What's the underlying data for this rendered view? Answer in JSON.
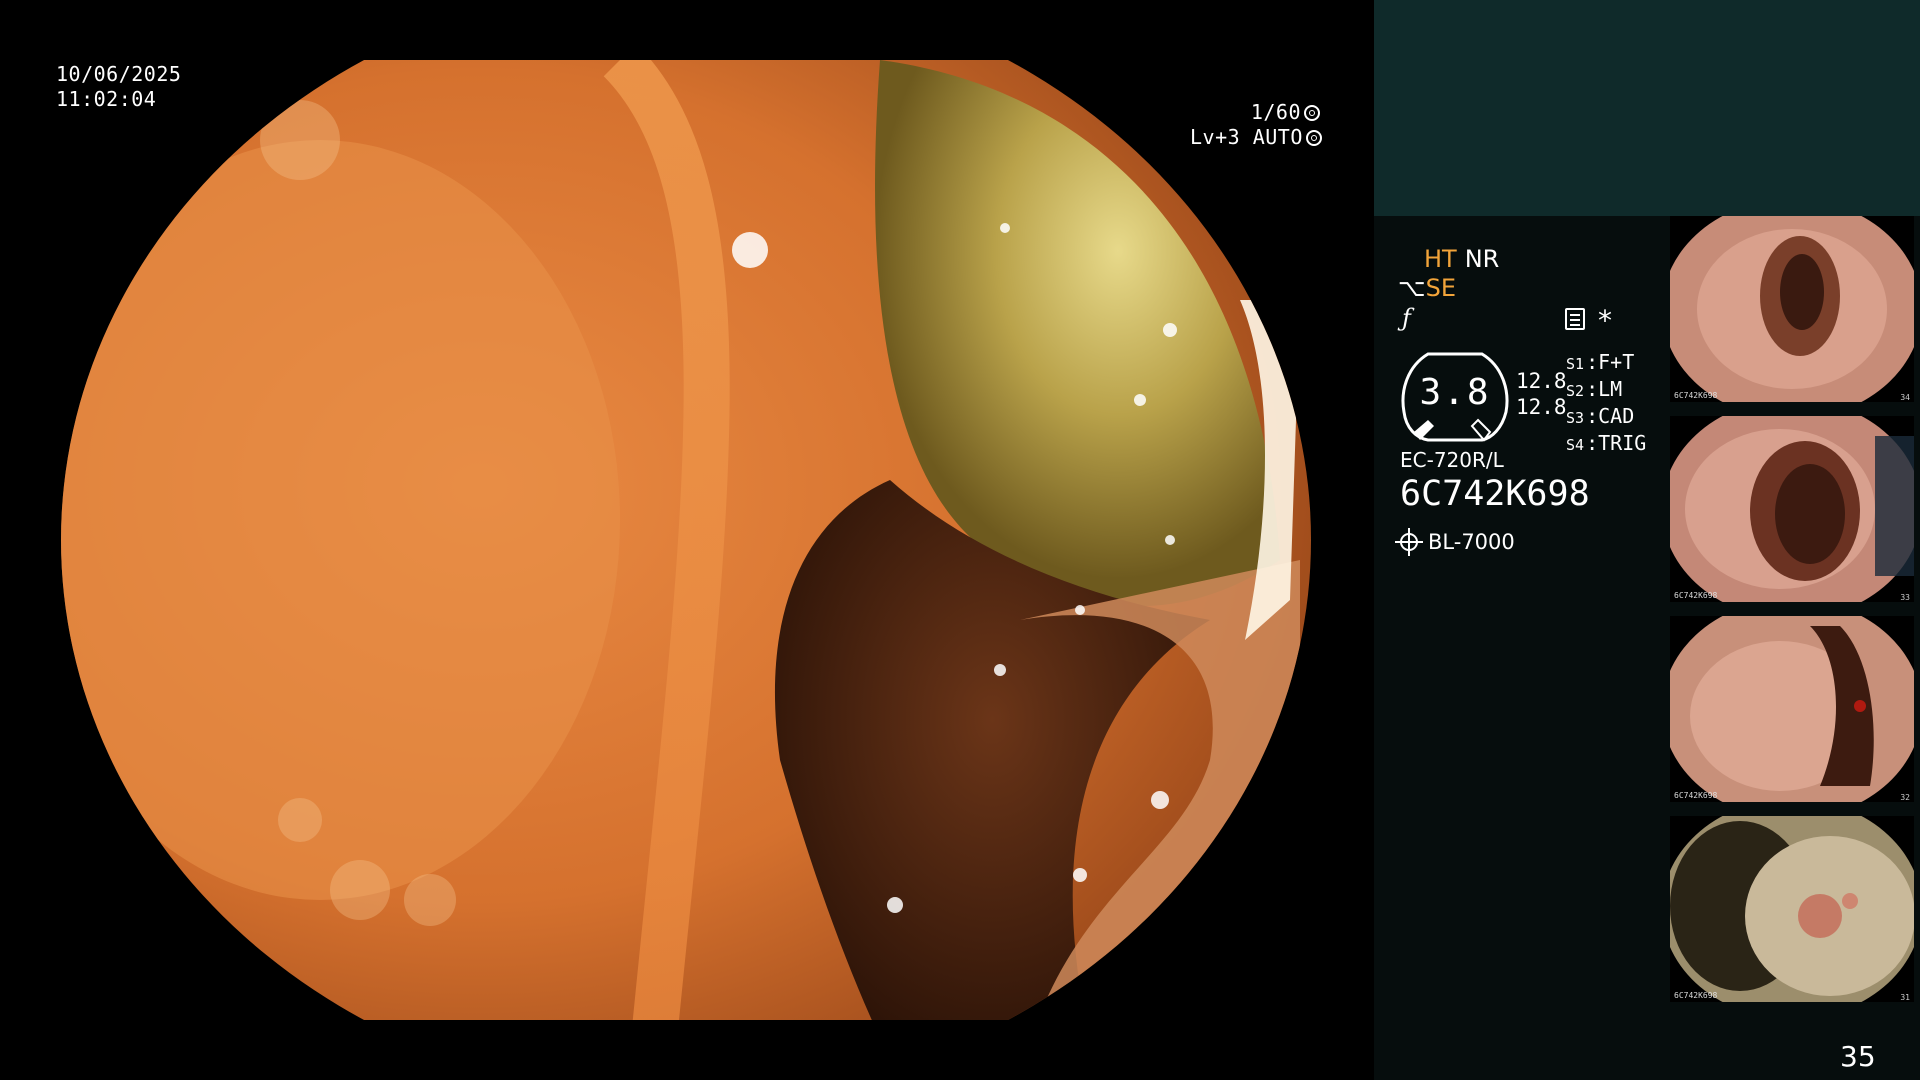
{
  "overlay": {
    "date": "10/06/2025",
    "time": "11:02:04",
    "shutter": "1/60",
    "level": "Lv+3 AUTO"
  },
  "panel": {
    "modes": {
      "ht": "HT",
      "nr": "NR",
      "se": "SE"
    },
    "gauge_value": "3.8",
    "side_values": [
      "12.8",
      "12.8"
    ],
    "slots": [
      {
        "key": "S1",
        "value": "F+T"
      },
      {
        "key": "S2",
        "value": "LM"
      },
      {
        "key": "S3",
        "value": "CAD"
      },
      {
        "key": "S4",
        "value": "TRIG"
      }
    ],
    "model": "EC-720R/L",
    "serial": "6C742K698",
    "light_source": "BL-7000",
    "colors": {
      "accent": "#f2a43a",
      "panel_top": "#0f2a2a",
      "panel_bg": "#060d0d"
    }
  },
  "thumbnails": [
    {
      "serial": "6C742K698",
      "number": "34"
    },
    {
      "serial": "6C742K698",
      "number": "33"
    },
    {
      "serial": "6C742K698",
      "number": "32"
    },
    {
      "serial": "6C742K698",
      "number": "31"
    }
  ],
  "page_number": "35"
}
